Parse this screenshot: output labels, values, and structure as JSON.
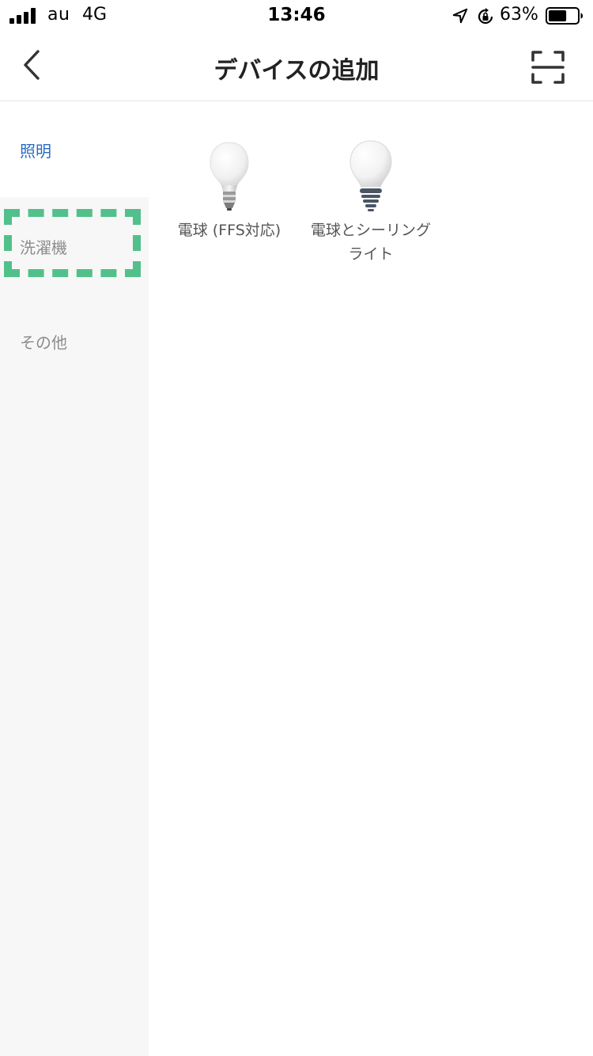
{
  "status_bar": {
    "carrier": "au",
    "network": "4G",
    "time": "13:46",
    "battery_percent": "63%",
    "battery_level": 0.63,
    "icons": [
      "signal-icon",
      "location-icon",
      "rotation-lock-icon",
      "battery-icon"
    ]
  },
  "nav": {
    "title": "デバイスの追加",
    "back_icon": "chevron-left-icon",
    "scan_icon": "scan-icon"
  },
  "sidebar": {
    "items": [
      {
        "label": "照明",
        "active": true
      },
      {
        "label": "洗濯機",
        "active": false,
        "highlighted": true
      },
      {
        "label": "その他",
        "active": false
      }
    ]
  },
  "devices": [
    {
      "label": "電球 (FFS対応)",
      "icon": "led-bulb-icon"
    },
    {
      "label": "電球とシーリングライト",
      "icon": "classic-bulb-icon"
    }
  ],
  "colors": {
    "accent": "#2a6cbf",
    "highlight": "#52c08a",
    "sidebar_bg": "#f7f7f7",
    "text_muted": "#8c8c8c"
  }
}
